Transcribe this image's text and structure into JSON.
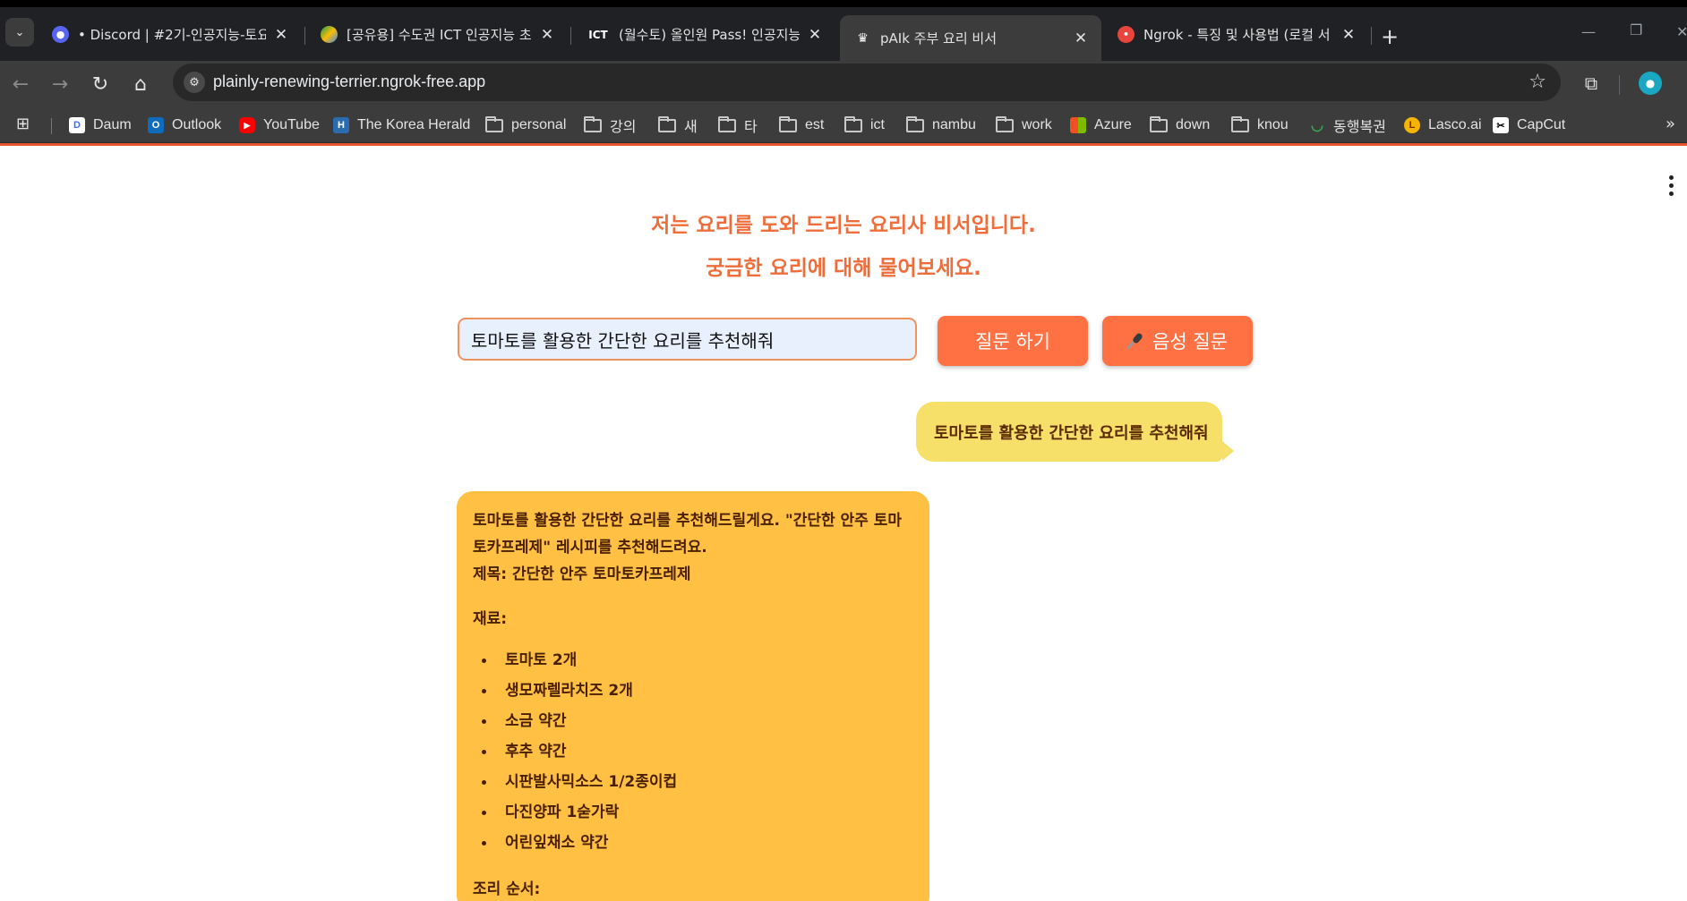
{
  "browser": {
    "tabs": [
      {
        "title": "• Discord | #2기-인공지능-토요",
        "favicon_color": "#5865f2",
        "active": false
      },
      {
        "title": "[공유용] 수도권 ICT 인공지능 초",
        "favicon_color": "#fbbc04",
        "active": false
      },
      {
        "title": "(월수토) 올인원 Pass! 인공지능",
        "favicon_text": "ICT",
        "active": false
      },
      {
        "title": "pAIk 주부 요리 비서",
        "favicon_color": "#ffffff",
        "active": true
      },
      {
        "title": "Ngrok - 특징 및 사용법 (로컬 서",
        "favicon_color": "#e8453c",
        "active": false
      }
    ],
    "url": "plainly-renewing-terrier.ngrok-free.app",
    "bookmarks": [
      {
        "label": "Daum",
        "type": "site",
        "icon_text": "D",
        "icon_color": "#3f6df5"
      },
      {
        "label": "Outlook",
        "type": "site",
        "icon_text": "O",
        "icon_color": "#0f6cbd"
      },
      {
        "label": "YouTube",
        "type": "site",
        "icon_text": "▶",
        "icon_color": "#ff0000"
      },
      {
        "label": "The Korea Herald",
        "type": "site",
        "icon_text": "H",
        "icon_color": "#2b6cb0"
      },
      {
        "label": "personal",
        "type": "folder"
      },
      {
        "label": "강의",
        "type": "folder"
      },
      {
        "label": "새",
        "type": "folder"
      },
      {
        "label": "타",
        "type": "folder"
      },
      {
        "label": "est",
        "type": "folder"
      },
      {
        "label": "ict",
        "type": "folder"
      },
      {
        "label": "nambu",
        "type": "folder"
      },
      {
        "label": "work",
        "type": "folder"
      },
      {
        "label": "Azure",
        "type": "site",
        "icon_text": "⊞",
        "icon_color": "#f25022"
      },
      {
        "label": "down",
        "type": "folder"
      },
      {
        "label": "knou",
        "type": "folder"
      },
      {
        "label": "동행복권",
        "type": "site",
        "icon_text": "◡",
        "icon_color": "#3c3c3c"
      },
      {
        "label": "Lasco.ai",
        "type": "site",
        "icon_text": "L",
        "icon_color": "#f4b400"
      },
      {
        "label": "CapCut",
        "type": "site",
        "icon_text": "✂",
        "icon_color": "#000000"
      }
    ]
  },
  "app": {
    "intro_line1": "저는 요리를 도와 드리는 요리사 비서입니다.",
    "intro_line2": "궁금한 요리에 대해 물어보세요.",
    "question_value": "토마토를 활용한 간단한 요리를 추천해줘",
    "ask_button": "질문 하기",
    "voice_button": "음성 질문",
    "accent_color": "#ff7043",
    "user_message": "토마토를 활용한 간단한 요리를 추천해줘",
    "bot_message": {
      "intro": "토마토를 활용한 간단한 요리를 추천해드릴게요. \"간단한 안주 토마토카프레제\" 레시피를 추천해드려요.",
      "title_line": "제목: 간단한 안주 토마토카프레제",
      "ingredients_heading": "재료:",
      "ingredients": [
        "토마토 2개",
        "생모짜렐라치즈 2개",
        "소금 약간",
        "후추 약간",
        "시판발사믹소스 1/2종이컵",
        "다진양파 1숟가락",
        "어린잎채소 약간"
      ],
      "steps_heading": "조리 순서:"
    }
  }
}
